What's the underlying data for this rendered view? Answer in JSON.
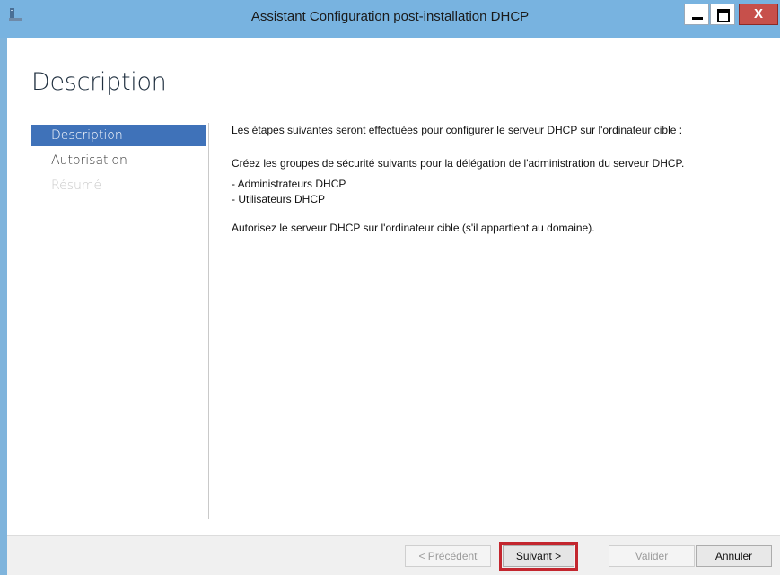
{
  "window": {
    "title": "Assistant Configuration post-installation DHCP",
    "close_label": "X",
    "accent": "#78b3e0",
    "close_color": "#c7504b"
  },
  "page": {
    "heading": "Description"
  },
  "nav": {
    "items": [
      {
        "label": "Description",
        "state": "active"
      },
      {
        "label": "Autorisation",
        "state": "normal"
      },
      {
        "label": "Résumé",
        "state": "disabled"
      }
    ]
  },
  "content": {
    "intro": "Les étapes suivantes seront effectuées pour configurer le serveur DHCP sur l'ordinateur cible :",
    "groups_text": "Créez les groupes de sécurité suivants pour la délégation de l'administration du serveur DHCP.",
    "groups": [
      "- Administrateurs DHCP",
      "- Utilisateurs DHCP"
    ],
    "authorize_text": "Autorisez le serveur DHCP sur l'ordinateur cible (s'il appartient au domaine)."
  },
  "footer": {
    "prev_label": "< Précédent",
    "next_label": "Suivant >",
    "validate_label": "Valider",
    "cancel_label": "Annuler",
    "highlight_color": "#c3262e"
  }
}
